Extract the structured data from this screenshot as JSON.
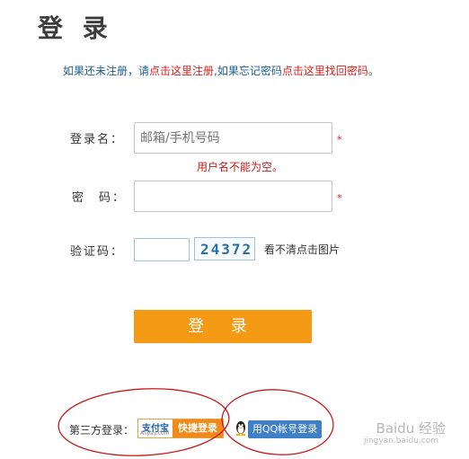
{
  "page": {
    "title": "登 录"
  },
  "notice": {
    "prefix": "如果还未注册，请",
    "register_link": "点击这里注册",
    "middle": ",如果忘记密码",
    "forgot_link": "点击这里找回密码",
    "suffix": "。"
  },
  "form": {
    "username": {
      "label": "登录名：",
      "placeholder": "邮箱/手机号码",
      "value": "",
      "required_mark": "*",
      "error": "用户名不能为空。"
    },
    "password": {
      "label": "密　码：",
      "value": "",
      "required_mark": "*"
    },
    "captcha": {
      "label": "验证码：",
      "value": "",
      "image_text": "24372",
      "refresh_text": "看不清点击图片"
    },
    "submit_label": "登 录"
  },
  "third_party": {
    "label": "第三方登录：",
    "alipay": {
      "logo_text": "支付宝",
      "logo_sub": "Alipay.com",
      "button_text": "快捷登录"
    },
    "qq": {
      "button_text": "用QQ帐号登录"
    }
  },
  "watermark": {
    "text": "Baidu 经验",
    "sub": "jingyan.baidu.com"
  },
  "colors": {
    "accent": "#f59a14",
    "link": "#d7221e",
    "notice": "#1f5f8f",
    "qq": "#3f7fc6",
    "annotation": "#c41a1a"
  }
}
